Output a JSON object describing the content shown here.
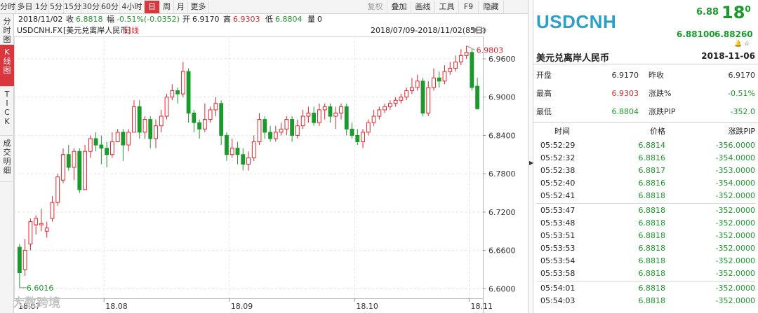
{
  "toolbar": {
    "left_buttons": [
      {
        "label": "分时",
        "active": false
      },
      {
        "label": "多日",
        "active": false
      },
      {
        "label": "1分",
        "active": false
      },
      {
        "label": "5分",
        "active": false
      },
      {
        "label": "15分",
        "active": false
      },
      {
        "label": "30分",
        "active": false
      },
      {
        "label": "60分",
        "active": false
      },
      {
        "label": "4小时",
        "active": false
      },
      {
        "label": "日",
        "active": true
      },
      {
        "label": "周",
        "active": false
      },
      {
        "label": "月",
        "active": false
      },
      {
        "label": "更多",
        "active": false
      }
    ],
    "right_buttons": [
      {
        "label": "复权",
        "disabled": true
      },
      {
        "label": "叠加",
        "disabled": false
      },
      {
        "label": "画线",
        "disabled": false
      },
      {
        "label": "工具",
        "disabled": false
      },
      {
        "label": "F9",
        "disabled": false
      },
      {
        "label": "隐藏",
        "disabled": false
      }
    ]
  },
  "left_tabs": [
    {
      "label": "分\n时\n图",
      "active": false
    },
    {
      "label": "K\n线\n图",
      "active": true
    },
    {
      "label": "T\nI\nC\nK",
      "active": false
    },
    {
      "label": "成\n交\n明\n细",
      "active": false
    }
  ],
  "info": {
    "date": "2018/11/02",
    "close_label": "收",
    "close": "6.8818",
    "change_label": "幅",
    "change": "-0.51%(-0.0352)",
    "open_label": "开",
    "open": "6.9170",
    "high_label": "高",
    "high": "6.9303",
    "low_label": "低",
    "low": "6.8804",
    "vol_label": "量",
    "vol": "0"
  },
  "chart_title": {
    "symbol": "USDCNH.FX",
    "name": "[美元兑离岸人民币]",
    "period": "日线",
    "range": "2018/07/09-2018/11/02(85日)"
  },
  "chart_data": {
    "type": "candlestick",
    "ylim": [
      6.585,
      6.995
    ],
    "yticks": [
      "6.9600",
      "6.9000",
      "6.8400",
      "6.7800",
      "6.7200",
      "6.6600",
      "6.6000"
    ],
    "xticks": [
      "18.07",
      "18.08",
      "18.09",
      "18.10",
      "18.11"
    ],
    "max_label": "6.9803",
    "min_label": "6.6016",
    "colors": {
      "up": "#e0262d",
      "down": "#1b9a2c"
    },
    "candles": [
      [
        6.665,
        6.625,
        6.67,
        6.6016
      ],
      [
        6.63,
        6.66,
        6.678,
        6.62
      ],
      [
        6.67,
        6.705,
        6.71,
        6.66
      ],
      [
        6.7,
        6.71,
        6.715,
        6.685
      ],
      [
        6.7,
        6.702,
        6.725,
        6.69
      ],
      [
        6.69,
        6.695,
        6.705,
        6.68
      ],
      [
        6.71,
        6.735,
        6.745,
        6.705
      ],
      [
        6.735,
        6.775,
        6.78,
        6.73
      ],
      [
        6.77,
        6.81,
        6.82,
        6.765
      ],
      [
        6.81,
        6.79,
        6.825,
        6.785
      ],
      [
        6.79,
        6.815,
        6.82,
        6.77
      ],
      [
        6.815,
        6.755,
        6.82,
        6.75
      ],
      [
        6.755,
        6.815,
        6.825,
        6.755
      ],
      [
        6.815,
        6.835,
        6.84,
        6.805
      ],
      [
        6.835,
        6.825,
        6.845,
        6.815
      ],
      [
        6.825,
        6.82,
        6.84,
        6.795
      ],
      [
        6.82,
        6.81,
        6.83,
        6.79
      ],
      [
        6.81,
        6.83,
        6.845,
        6.805
      ],
      [
        6.83,
        6.845,
        6.85,
        6.83
      ],
      [
        6.845,
        6.825,
        6.85,
        6.8
      ],
      [
        6.825,
        6.845,
        6.85,
        6.815
      ],
      [
        6.845,
        6.885,
        6.895,
        6.845
      ],
      [
        6.885,
        6.845,
        6.895,
        6.835
      ],
      [
        6.845,
        6.865,
        6.87,
        6.835
      ],
      [
        6.865,
        6.835,
        6.87,
        6.82
      ],
      [
        6.835,
        6.855,
        6.865,
        6.82
      ],
      [
        6.855,
        6.87,
        6.88,
        6.845
      ],
      [
        6.87,
        6.9,
        6.905,
        6.865
      ],
      [
        6.9,
        6.91,
        6.92,
        6.895
      ],
      [
        6.91,
        6.905,
        6.915,
        6.89
      ],
      [
        6.905,
        6.94,
        6.955,
        6.9
      ],
      [
        6.94,
        6.875,
        6.945,
        6.86
      ],
      [
        6.875,
        6.86,
        6.88,
        6.845
      ],
      [
        6.86,
        6.85,
        6.865,
        6.835
      ],
      [
        6.85,
        6.865,
        6.89,
        6.845
      ],
      [
        6.865,
        6.88,
        6.885,
        6.86
      ],
      [
        6.88,
        6.89,
        6.9,
        6.87
      ],
      [
        6.89,
        6.84,
        6.895,
        6.825
      ],
      [
        6.84,
        6.81,
        6.845,
        6.8
      ],
      [
        6.81,
        6.82,
        6.835,
        6.805
      ],
      [
        6.82,
        6.81,
        6.83,
        6.795
      ],
      [
        6.81,
        6.795,
        6.82,
        6.785
      ],
      [
        6.795,
        6.805,
        6.815,
        6.785
      ],
      [
        6.805,
        6.83,
        6.84,
        6.8
      ],
      [
        6.83,
        6.865,
        6.875,
        6.825
      ],
      [
        6.865,
        6.845,
        6.87,
        6.835
      ],
      [
        6.845,
        6.835,
        6.855,
        6.83
      ],
      [
        6.835,
        6.845,
        6.855,
        6.83
      ],
      [
        6.845,
        6.85,
        6.86,
        6.84
      ],
      [
        6.85,
        6.865,
        6.87,
        6.84
      ],
      [
        6.865,
        6.84,
        6.87,
        6.83
      ],
      [
        6.84,
        6.855,
        6.865,
        6.835
      ],
      [
        6.855,
        6.87,
        6.88,
        6.85
      ],
      [
        6.87,
        6.875,
        6.885,
        6.86
      ],
      [
        6.875,
        6.86,
        6.885,
        6.855
      ],
      [
        6.86,
        6.88,
        6.89,
        6.855
      ],
      [
        6.88,
        6.885,
        6.89,
        6.865
      ],
      [
        6.885,
        6.87,
        6.89,
        6.86
      ],
      [
        6.87,
        6.875,
        6.885,
        6.85
      ],
      [
        6.875,
        6.885,
        6.89,
        6.865
      ],
      [
        6.885,
        6.85,
        6.89,
        6.84
      ],
      [
        6.85,
        6.84,
        6.86,
        6.835
      ],
      [
        6.84,
        6.83,
        6.85,
        6.825
      ],
      [
        6.83,
        6.845,
        6.85,
        6.82
      ],
      [
        6.845,
        6.86,
        6.865,
        6.84
      ],
      [
        6.86,
        6.87,
        6.88,
        6.855
      ],
      [
        6.87,
        6.88,
        6.885,
        6.865
      ],
      [
        6.88,
        6.885,
        6.89,
        6.875
      ],
      [
        6.885,
        6.89,
        6.895,
        6.88
      ],
      [
        6.89,
        6.895,
        6.9,
        6.885
      ],
      [
        6.895,
        6.9,
        6.905,
        6.89
      ],
      [
        6.9,
        6.91,
        6.915,
        6.895
      ],
      [
        6.91,
        6.915,
        6.93,
        6.905
      ],
      [
        6.915,
        6.925,
        6.935,
        6.91
      ],
      [
        6.925,
        6.875,
        6.93,
        6.87
      ],
      [
        6.875,
        6.915,
        6.925,
        6.87
      ],
      [
        6.915,
        6.93,
        6.945,
        6.91
      ],
      [
        6.93,
        6.925,
        6.94,
        6.915
      ],
      [
        6.925,
        6.94,
        6.95,
        6.92
      ],
      [
        6.94,
        6.945,
        6.955,
        6.935
      ],
      [
        6.945,
        6.955,
        6.965,
        6.94
      ],
      [
        6.955,
        6.965,
        6.975,
        6.95
      ],
      [
        6.965,
        6.97,
        6.9803,
        6.96
      ],
      [
        6.97,
        6.915,
        6.975,
        6.91
      ],
      [
        6.917,
        6.8818,
        6.9303,
        6.8804
      ]
    ]
  },
  "quote": {
    "symbol": "USDCNH",
    "last_small": "6.88",
    "last_large": "18",
    "last_tail": "0",
    "bid": "6.88100",
    "ask": "6.88260",
    "icons": "🔔 ☆",
    "name": "美元兑离岸人民币",
    "date": "2018-11-06",
    "rows": [
      {
        "l1": "开盘",
        "v1": "6.9170",
        "c1": "#333",
        "l2": "昨收",
        "v2": "6.9170",
        "c2": "#333"
      },
      {
        "l1": "最高",
        "v1": "6.9303",
        "c1": "#e0262d",
        "l2": "涨跌%",
        "v2": "-0.51%",
        "c2": "#1b9a2c"
      },
      {
        "l1": "最低",
        "v1": "6.8804",
        "c1": "#1b9a2c",
        "l2": "涨跌PIP",
        "v2": "-352.0",
        "c2": "#1b9a2c"
      }
    ]
  },
  "ticks": {
    "headers": [
      "时间",
      "价格",
      "涨跌PIP"
    ],
    "rows": [
      [
        "05:52:29",
        "6.8814",
        "-356.0000"
      ],
      [
        "05:52:32",
        "6.8816",
        "-354.0000"
      ],
      [
        "05:52:38",
        "6.8817",
        "-353.0000"
      ],
      [
        "05:52:40",
        "6.8816",
        "-354.0000"
      ],
      [
        "05:52:41",
        "6.8818",
        "-352.0000"
      ],
      [
        "05:53:47",
        "6.8818",
        "-352.0000"
      ],
      [
        "05:53:48",
        "6.8818",
        "-352.0000"
      ],
      [
        "05:53:51",
        "6.8818",
        "-352.0000"
      ],
      [
        "05:53:53",
        "6.8818",
        "-352.0000"
      ],
      [
        "05:53:54",
        "6.8818",
        "-352.0000"
      ],
      [
        "05:53:58",
        "6.8818",
        "-352.0000"
      ],
      [
        "05:54:01",
        "6.8818",
        "-352.0000"
      ],
      [
        "05:54:03",
        "6.8818",
        "-352.0000"
      ]
    ],
    "group_breaks": [
      5,
      11
    ]
  },
  "watermark": "大数跨境"
}
